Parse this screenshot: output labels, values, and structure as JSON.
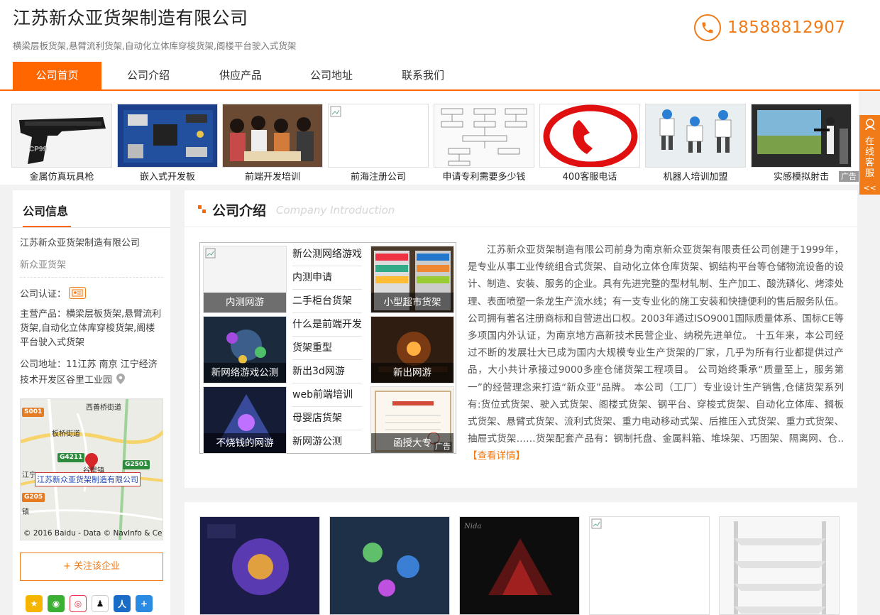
{
  "header": {
    "company_name": "江苏新众亚货架制造有限公司",
    "subtitle": "横梁层板货架,悬臂流利货架,自动化立体库穿梭货架,阁楼平台驶入式货架",
    "phone": "18588812907",
    "accent_color": "#f07b18"
  },
  "nav": {
    "items": [
      {
        "label": "公司首页",
        "active": true
      },
      {
        "label": "公司介绍",
        "active": false
      },
      {
        "label": "供应产品",
        "active": false
      },
      {
        "label": "公司地址",
        "active": false
      },
      {
        "label": "联系我们",
        "active": false
      }
    ]
  },
  "strip": {
    "items": [
      {
        "label": "金属仿真玩具枪",
        "image": "toy-pistol"
      },
      {
        "label": "嵌入式开发板",
        "image": "circuit-board"
      },
      {
        "label": "前端开发培训",
        "image": "classroom-people"
      },
      {
        "label": "前海注册公司",
        "image": "broken-image"
      },
      {
        "label": "申请专利需要多少钱",
        "image": "flowchart"
      },
      {
        "label": "400客服电话",
        "image": "phone-logo"
      },
      {
        "label": "机器人培训加盟",
        "image": "robot-toys"
      },
      {
        "label": "实感模拟射击",
        "image": "shooting-simulator"
      }
    ],
    "ad_label": "广告"
  },
  "side_service": {
    "label": "在线客服",
    "arrow": "<<"
  },
  "sidebar": {
    "title": "公司信息",
    "company_name": "江苏新众亚货架制造有限公司",
    "short_name": "新众亚货架",
    "certification_label": "公司认证：",
    "main_products": "主营产品：横梁层板货架,悬臂流利货架,自动化立体库穿梭货架,阁楼平台驶入式货架",
    "address": "公司地址：11江苏 南京 江宁经济技术开发区谷里工业园",
    "map": {
      "labels": [
        "西善桥街道",
        "板桥街道",
        "江宁",
        "谷里镇",
        "镇"
      ],
      "shields": [
        "S001",
        "G4211",
        "G2501",
        "G205"
      ],
      "callout": "江苏新众亚货架制造有限公司",
      "copyright": "© 2016 Baidu - Data © NavInfo & Ce"
    },
    "follow_button": "+ 关注该企业",
    "share_icons": [
      "qzone-icon",
      "wechat-icon",
      "weibo-icon",
      "qq-icon",
      "renren-icon",
      "more-share-icon"
    ]
  },
  "intro": {
    "title": "公司介绍",
    "subtitle_en": "Company Introduction",
    "grid": {
      "cells": [
        {
          "caption": "内测网游",
          "image": "broken-image"
        },
        {
          "caption": "小型超市货架",
          "image": "supermarket-shelf"
        },
        {
          "caption": "新网络游戏公测",
          "image": "game-screen-1"
        },
        {
          "caption": "新出网游",
          "image": "game-screen-2"
        },
        {
          "caption": "不烧钱的网游",
          "image": "game-screen-3"
        },
        {
          "caption": "函授大专",
          "image": "diploma"
        }
      ],
      "links": [
        "新公测网络游戏",
        "内测申请",
        "二手柜台货架",
        "什么是前端开发",
        "货架重型",
        "新出3d网游",
        "web前端培训",
        "母婴店货架",
        "新网游公测"
      ],
      "ad_label": "广告"
    },
    "text": "江苏新众亚货架制造有限公司前身为南京新众亚货架有限责任公司创建于1999年，是专业从事工业传统组合式货架、自动化立体仓库货架、钢结构平台等仓储物流设备的设计、制造、安装、服务的企业。具有先进完整的型材轧制、生产加工、酸洗磷化、烤漆处理、表面喷塑一条龙生产流水线；有一支专业化的施工安装和快捷便利的售后服务队伍。公司拥有著名注册商标和自营进出口权。2003年通过ISO9001国际质量体系、国标CE等多项国内外认证，为南京地方高新技术民营企业、纳税先进单位。 十五年来，本公司经过不断的发展壮大已成为国内大规模专业生产货架的厂家，几乎为所有行业都提供过产品，大小共计承接过9000多座仓储货架工程项目。 公司始终秉承“质量至上，服务第一”的经营理念来打造“新众亚”品牌。 本公司（工厂）专业设计生产销售,仓储货架系列有:货位式货架、驶入式货架、阁楼式货架、钢平台、穿梭式货架、自动化立体库、搁板式货架、悬臂式货架、流利式货架、重力电动移动式架、后推压入式货架、重力式货架、抽屉式货架……货架配套产品有：钢制托盘、金属料箱、堆垛架、巧固架、隔离网、仓..",
    "more_link": "【查看详情】"
  },
  "gallery": {
    "images": [
      "game-screen-4",
      "game-screen-5",
      "dark-warrior-art",
      "broken-image",
      "white-shelf"
    ]
  }
}
